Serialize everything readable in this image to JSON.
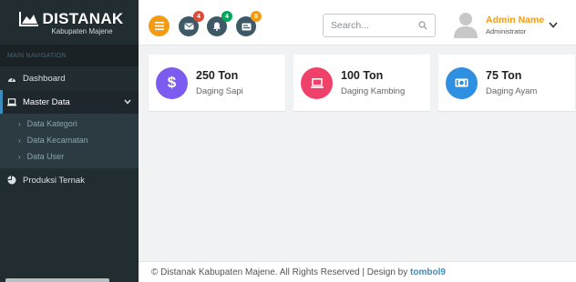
{
  "brand": {
    "title": "DISTANAK",
    "subtitle": "Kabupaten Majene"
  },
  "sidebar": {
    "header": "MAIN NAVIGATION",
    "items": [
      {
        "label": "Dashboard",
        "icon": "dashboard-icon"
      },
      {
        "label": "Master Data",
        "icon": "laptop-icon"
      },
      {
        "label": "Produksi Ternak",
        "icon": "pie-chart-icon"
      }
    ],
    "submenu": [
      {
        "label": "Data Kategori"
      },
      {
        "label": "Data Kecamatan"
      },
      {
        "label": "Data User"
      }
    ]
  },
  "header": {
    "search_placeholder": "Search...",
    "notifications": [
      {
        "icon": "envelope-icon",
        "count": "4",
        "badge_color": "#dd4b39"
      },
      {
        "icon": "bell-icon",
        "count": "4",
        "badge_color": "#00a65a"
      },
      {
        "icon": "tasks-icon",
        "count": "8",
        "badge_color": "#f39c12"
      }
    ],
    "user": {
      "name": "Admin Name",
      "role": "Administrator"
    }
  },
  "cards": [
    {
      "value": "250 Ton",
      "label": "Daging Sapi",
      "icon": "dollar-icon",
      "color": "#7c5cf0"
    },
    {
      "value": "100 Ton",
      "label": "Daging Kambing",
      "icon": "laptop-icon",
      "color": "#f0416a"
    },
    {
      "value": "75 Ton",
      "label": "Daging Ayam",
      "icon": "money-icon",
      "color": "#2f8fe0"
    }
  ],
  "footer": {
    "text": "© Distanak Kabupaten Majene. All Rights Reserved | Design by ",
    "link": "tombol9"
  },
  "colors": {
    "sidebar_bg": "#222d32",
    "accent_orange": "#f39c12",
    "link_blue": "#3c8dbc"
  }
}
